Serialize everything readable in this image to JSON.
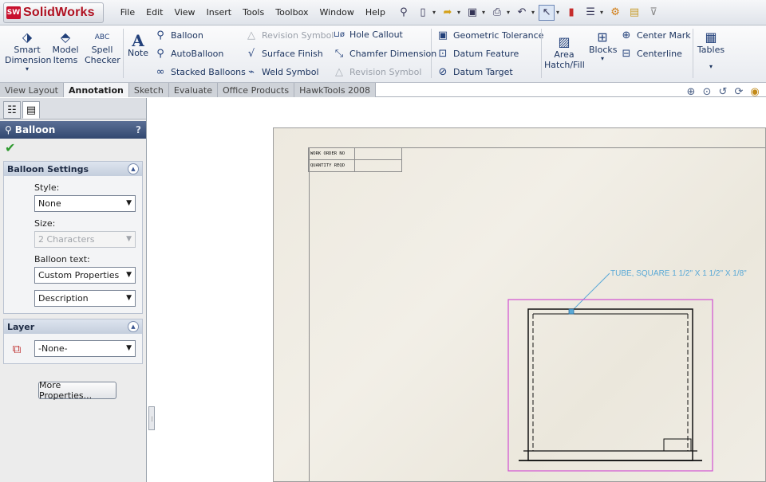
{
  "app": {
    "logo_badge": "SW",
    "name": "SolidWorks"
  },
  "menu": [
    "File",
    "Edit",
    "View",
    "Insert",
    "Tools",
    "Toolbox",
    "Window",
    "Help"
  ],
  "ribbon": {
    "smart_dimension": "Smart Dimension",
    "model_items": "Model Items",
    "spell_checker": "Spell Checker",
    "spell_abc": "ABC",
    "note": "Note",
    "balloon": "Balloon",
    "autoballoon": "AutoBalloon",
    "stacked_balloons": "Stacked Balloons",
    "revision_symbol": "Revision Symbol",
    "surface_finish": "Surface Finish",
    "weld_symbol": "Weld Symbol",
    "hole_callout": "Hole Callout",
    "chamfer_dimension": "Chamfer Dimension",
    "revision_symbol_2": "Revision Symbol",
    "geometric_tolerance": "Geometric Tolerance",
    "datum_feature": "Datum Feature",
    "datum_target": "Datum Target",
    "area_hatch_fill": "Area Hatch/Fill",
    "blocks": "Blocks",
    "center_mark": "Center Mark",
    "centerline": "Centerline",
    "tables": "Tables"
  },
  "tabs": [
    "View Layout",
    "Annotation",
    "Sketch",
    "Evaluate",
    "Office Products",
    "HawkTools 2008"
  ],
  "active_tab": "Annotation",
  "panel": {
    "title": "Balloon",
    "help": "?",
    "balloon_settings": {
      "header": "Balloon Settings",
      "style_label": "Style:",
      "style_value": "None",
      "size_label": "Size:",
      "size_value": "2 Characters",
      "text_label": "Balloon text:",
      "text_value": "Custom Properties",
      "property_value": "Description"
    },
    "layer": {
      "header": "Layer",
      "value": "-None-"
    },
    "more_properties": "More Properties..."
  },
  "drawing": {
    "table_rows": [
      "WORK ORDER NO",
      "QUANTITY REQD"
    ],
    "note": "TUBE, SQUARE 1 1/2\" X 1 1/2\" X 1/8\""
  }
}
